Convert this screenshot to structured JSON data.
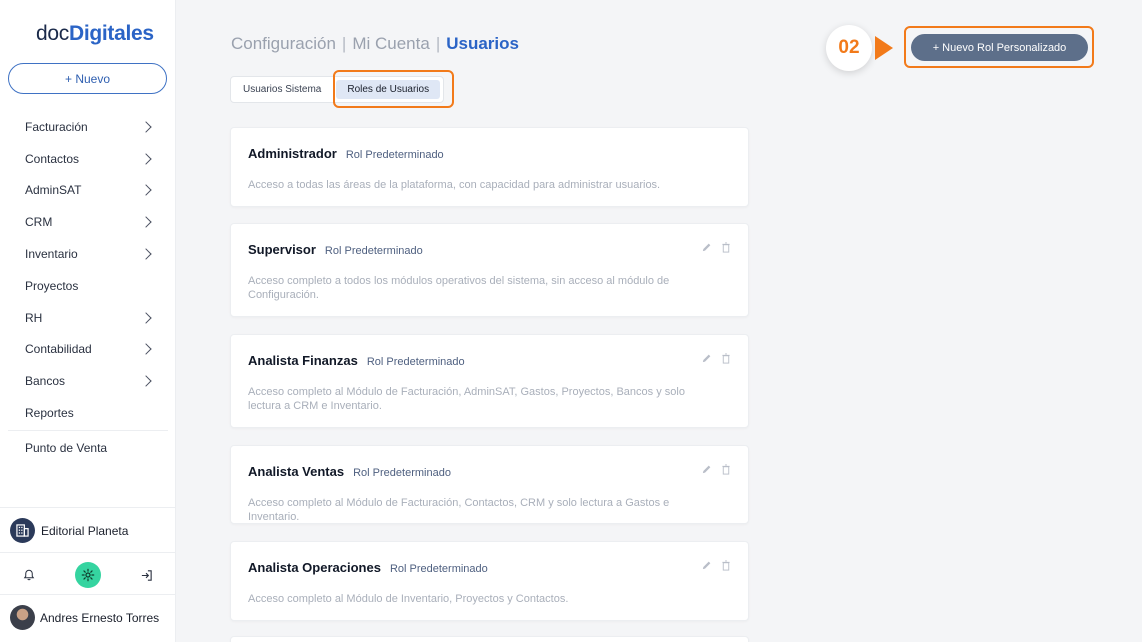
{
  "sidebar": {
    "logo": {
      "part1": "doc",
      "part2": "Digitales"
    },
    "new_button": "+ Nuevo",
    "nav": [
      {
        "label": "Facturación",
        "chevron": true
      },
      {
        "label": "Contactos",
        "chevron": true
      },
      {
        "label": "AdminSAT",
        "chevron": true
      },
      {
        "label": "CRM",
        "chevron": true
      },
      {
        "label": "Inventario",
        "chevron": true
      },
      {
        "label": "Proyectos",
        "chevron": false
      },
      {
        "label": "RH",
        "chevron": true
      },
      {
        "label": "Contabilidad",
        "chevron": true
      },
      {
        "label": "Bancos",
        "chevron": true
      },
      {
        "label": "Reportes",
        "chevron": false
      }
    ],
    "pos": "Punto de Venta",
    "company": "Editorial Planeta",
    "tools": [
      "bell-icon",
      "gear-icon",
      "logout-icon"
    ],
    "user": "Andres Ernesto Torres"
  },
  "breadcrumb": {
    "a": "Configuración",
    "b": "Mi Cuenta",
    "c": "Usuarios",
    "sep": "|"
  },
  "tabs": {
    "system": "Usuarios Sistema",
    "roles": "Roles de Usuarios"
  },
  "cta": {
    "label": "+ Nuevo Rol Personalizado",
    "step": "02"
  },
  "colors": {
    "accent": "#2b64c6",
    "highlight": "#f27a1a",
    "cta_bg": "#5d6f8a",
    "gear_bg": "#35d4a0"
  },
  "roles": [
    {
      "title": "Administrador",
      "tag": "Rol Predeterminado",
      "desc": "Acceso a todas las áreas de la plataforma, con capacidad para administrar usuarios.",
      "actions": false
    },
    {
      "title": "Supervisor",
      "tag": "Rol Predeterminado",
      "desc": "Acceso completo a todos los módulos operativos del sistema, sin acceso al módulo de Configuración.",
      "actions": true
    },
    {
      "title": "Analista Finanzas",
      "tag": "Rol Predeterminado",
      "desc": "Acceso completo al Módulo de Facturación, AdminSAT, Gastos, Proyectos, Bancos y solo lectura a CRM e Inventario.",
      "actions": true
    },
    {
      "title": "Analista Ventas",
      "tag": "Rol Predeterminado",
      "desc": "Acceso completo al Módulo de Facturación, Contactos, CRM y solo lectura a Gastos e Inventario.",
      "actions": true
    },
    {
      "title": "Analista Operaciones",
      "tag": "Rol Predeterminado",
      "desc": "Acceso completo al Módulo de Inventario, Proyectos y Contactos.",
      "actions": true
    }
  ]
}
